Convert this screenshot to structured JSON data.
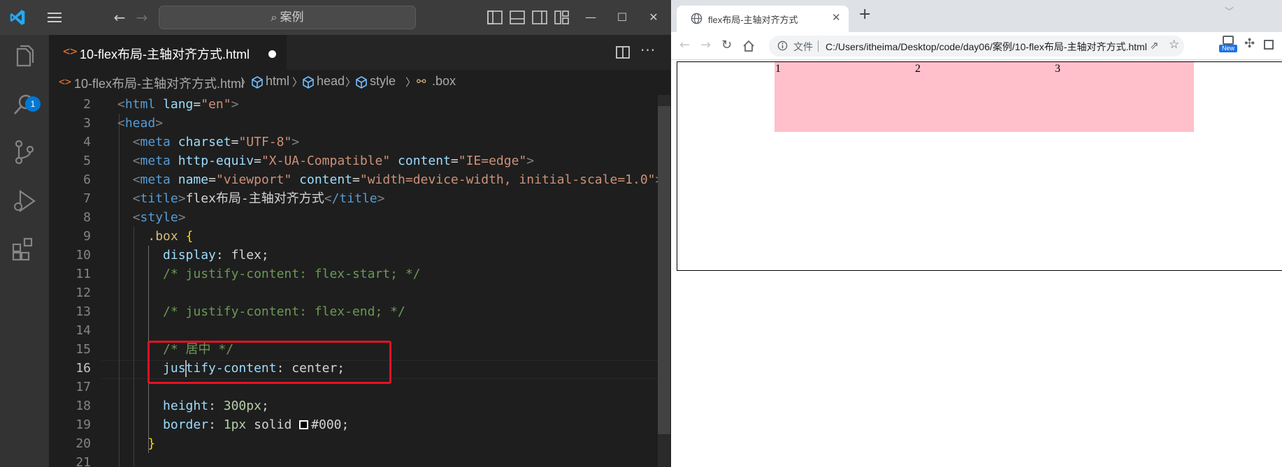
{
  "vscode": {
    "command_center": "案例",
    "activity_badge": "1",
    "tab": {
      "label": "10-flex布局-主轴对齐方式.html"
    },
    "breadcrumb": {
      "file": "10-flex布局-主轴对齐方式.html",
      "html": "html",
      "head": "head",
      "style": "style",
      "selector": ".box"
    },
    "line_numbers": [
      "2",
      "3",
      "4",
      "5",
      "6",
      "7",
      "8",
      "9",
      "10",
      "11",
      "12",
      "13",
      "14",
      "15",
      "16",
      "17",
      "18",
      "19",
      "20",
      "21"
    ],
    "code": {
      "l2_tag": "html",
      "l2_attr": "lang",
      "l2_val": "\"en\"",
      "l3_tag": "head",
      "l4_tag": "meta",
      "l4_attr": "charset",
      "l4_val": "\"UTF-8\"",
      "l5_tag": "meta",
      "l5_attr1": "http-equiv",
      "l5_val1": "\"X-UA-Compatible\"",
      "l5_attr2": "content",
      "l5_val2": "\"IE=edge\"",
      "l6_tag": "meta",
      "l6_attr1": "name",
      "l6_val1": "\"viewport\"",
      "l6_attr2": "content",
      "l6_val2": "\"width=device-width, initial-scale=1.0\"",
      "l7_tag": "title",
      "l7_text": "flex布局-主轴对齐方式",
      "l7_close": "/title",
      "l8_tag": "style",
      "l9_selector": ".box",
      "l10_prop": "display",
      "l10_val": "flex;",
      "l11_comment": "/* justify-content: flex-start; */",
      "l13_comment": "/* justify-content: flex-end; */",
      "l15_comment": "/* 居中 */",
      "l16_prop_a": "justify",
      "l16_prop_b": "-content",
      "l16_val": "center;",
      "l18_prop": "height",
      "l18_val": "300px",
      "l19_prop": "border",
      "l19_val_num": "1px",
      "l19_val_rest": "solid",
      "l19_color": "#000;"
    }
  },
  "browser": {
    "tab_title": "flex布局-主轴对齐方式",
    "address_prefix": "文件",
    "url": "C:/Users/itheima/Desktop/code/day06/案例/10-flex布局-主轴对齐方式.html",
    "new_badge": "New",
    "items": [
      "1",
      "2",
      "3"
    ],
    "item_color": "#ffc0cb"
  }
}
